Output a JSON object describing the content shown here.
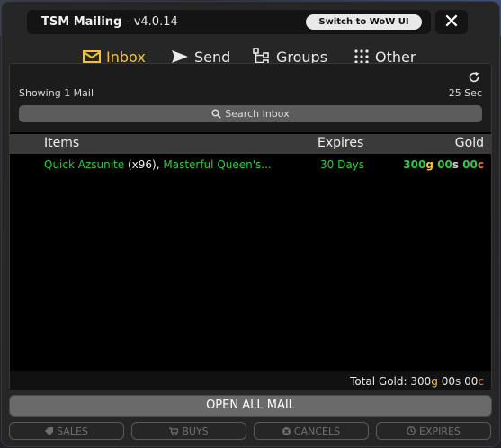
{
  "window": {
    "title": "TSM Mailing",
    "version": "- v4.0.14",
    "switch_label": "Switch to WoW UI",
    "close_glyph": "✕"
  },
  "nav": {
    "tabs": [
      {
        "label": "Inbox",
        "icon": "envelope-icon",
        "active": true
      },
      {
        "label": "Send",
        "icon": "send-icon",
        "active": false
      },
      {
        "label": "Groups",
        "icon": "groups-icon",
        "active": false
      },
      {
        "label": "Other",
        "icon": "grid-icon",
        "active": false
      }
    ]
  },
  "inbox": {
    "showing": "Showing 1 Mail",
    "timer": "25 Sec",
    "search_placeholder": "Search Inbox",
    "columns": {
      "items": "Items",
      "expires": "Expires",
      "gold": "Gold"
    },
    "rows": [
      {
        "item1": "Quick Azsunite",
        "qty": "(x96)",
        "sep": ",",
        "item2": "Masterful Queen's...",
        "expires": "30 Days",
        "gold_g": "300",
        "gold_g_unit": "g",
        "gold_s": "00",
        "gold_s_unit": "s",
        "gold_c": "00",
        "gold_c_unit": "c"
      }
    ],
    "total_label": "Total Gold:",
    "total_g": "300",
    "total_s": "00",
    "total_c": "00"
  },
  "actions": {
    "open_all": "OPEN ALL MAIL",
    "sales": "SALES",
    "buys": "BUYS",
    "cancels": "CANCELS",
    "expires": "EXPIRES"
  },
  "colors": {
    "accent": "#f1c33c",
    "green": "#2ecc40",
    "copper": "#e0773a"
  }
}
